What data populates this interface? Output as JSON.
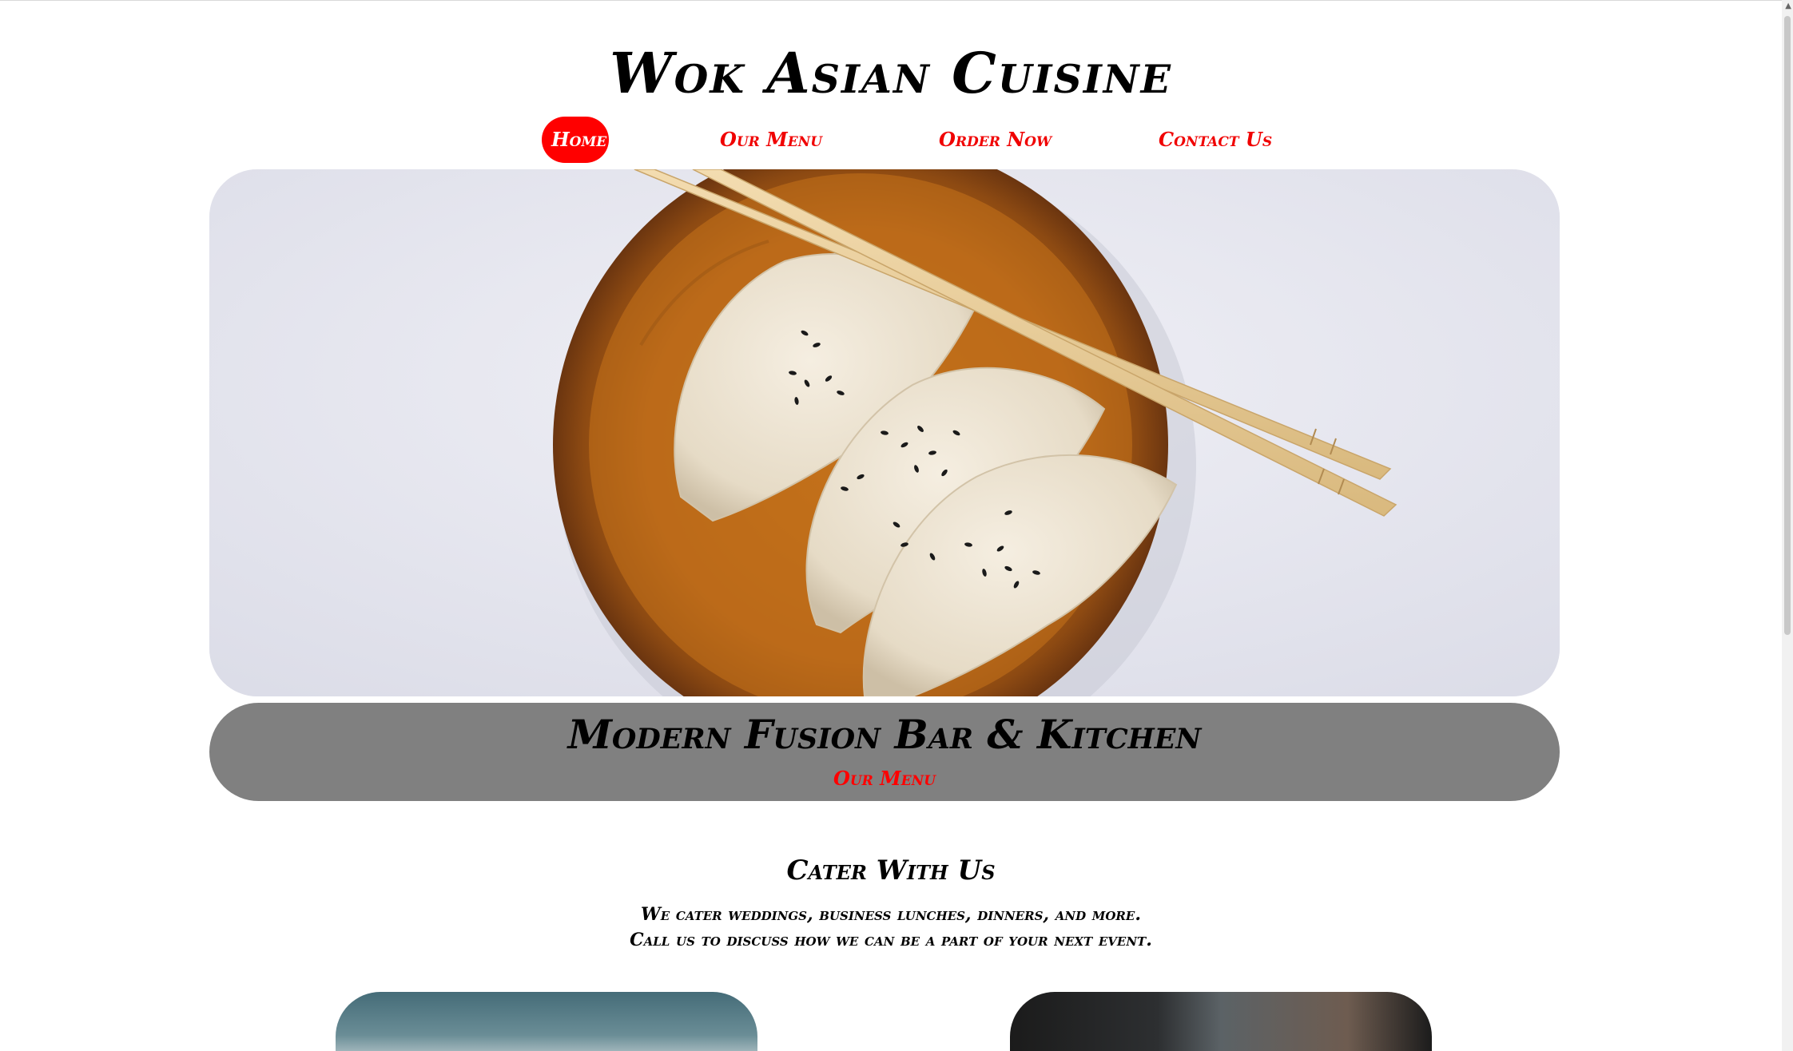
{
  "header": {
    "site_title": "Wok Asian Cuisine"
  },
  "nav": {
    "items": [
      {
        "label": "Home",
        "active": true
      },
      {
        "label": "Our Menu",
        "active": false
      },
      {
        "label": "Order Now",
        "active": false
      },
      {
        "label": "Contact Us",
        "active": false
      }
    ]
  },
  "hero": {
    "image": "dumplings-on-wooden-plate-with-chopsticks"
  },
  "banner": {
    "title": "Modern Fusion Bar & Kitchen",
    "link_label": "Our Menu"
  },
  "cater": {
    "title": "Cater With Us",
    "line1": "We cater weddings, business lunches, dinners, and more.",
    "line2": "Call us to discuss how we can be a part of your next event."
  },
  "colors": {
    "accent": "#ff0000",
    "banner_bg": "#808080",
    "page_bg": "#ffffff"
  }
}
